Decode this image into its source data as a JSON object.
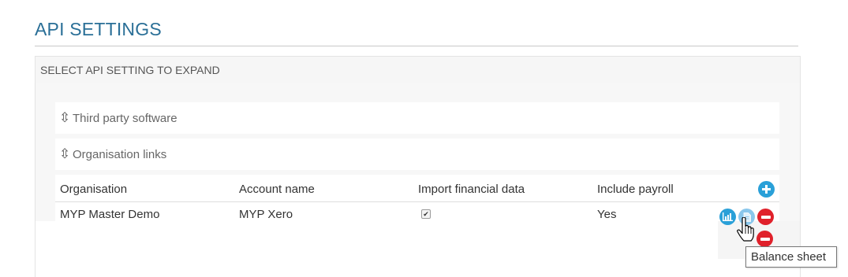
{
  "page": {
    "title": "API SETTINGS"
  },
  "panel": {
    "header": "SELECT API SETTING TO EXPAND",
    "sections": [
      {
        "label": "Third party software",
        "icon": "expand-vertical-icon"
      },
      {
        "label": "Organisation links",
        "icon": "expand-vertical-icon"
      }
    ]
  },
  "table": {
    "columns": [
      "Organisation",
      "Account name",
      "Import financial data",
      "Include payroll"
    ],
    "rows": [
      {
        "organisation": "MYP Master Demo",
        "account_name": "MYP Xero",
        "import_financial_data": true,
        "include_payroll": "Yes"
      }
    ],
    "add_icon": "plus-circle-icon",
    "row_actions": [
      "chart-icon",
      "balance-sheet-icon",
      "remove-icon",
      "remove-icon"
    ]
  },
  "tooltip": {
    "text": "Balance sheet"
  },
  "colors": {
    "title": "#2a6f97",
    "action_blue": "#2aa0d8",
    "action_red": "#e0212b"
  }
}
